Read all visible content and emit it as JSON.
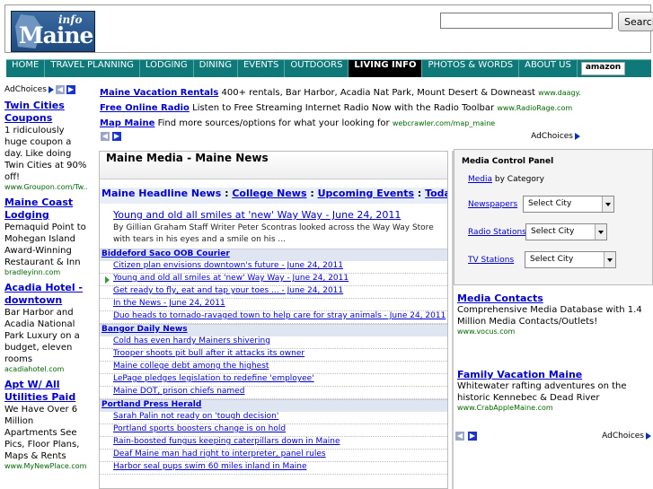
{
  "header": {
    "logo_word": "Maine",
    "logo_info": "info",
    "search_value": "",
    "search_button": "Search"
  },
  "nav": {
    "items": [
      "HOME",
      "TRAVEL PLANNING",
      "LODGING",
      "DINING",
      "EVENTS",
      "OUTDOORS",
      "LIVING INFO",
      "PHOTOS & WORDS",
      "ABOUT US"
    ],
    "active": "LIVING INFO",
    "amazon": "amazon"
  },
  "left_ads": {
    "adchoices": "AdChoices",
    "ads": [
      {
        "title": "Twin Cities Coupons",
        "desc": "1 ridiculously huge coupon a day. Like doing Twin Cities at 90% off!",
        "url": "www.Groupon.com/Tw..."
      },
      {
        "title": "Maine Coast Lodging",
        "desc": "Pemaquid Point to Mohegan Island Award-Winning Restaurant & Inn",
        "url": "bradleyinn.com"
      },
      {
        "title": "Acadia Hotel - downtown",
        "desc": "Bar Harbor and Acadia National Park Luxury on a budget, eleven rooms",
        "url": "acadiahotel.com"
      },
      {
        "title": "Apt W/ All Utilities Paid",
        "desc": "We Have Over 6 Million Apartments See Pics, Floor Plans, Maps & Rents",
        "url": "www.MyNewPlace.com"
      }
    ]
  },
  "top_ads": {
    "rows": [
      {
        "title": "Maine Vacation Rentals",
        "desc": "400+ rentals, Bar Harbor, Acadia Nat Park, Mount Desert & Downeast",
        "url": "www.daagy.com/For_Rent"
      },
      {
        "title": "Free Online Radio",
        "desc": "Listen to Free Streaming Internet Radio Now with the Radio Toolbar",
        "url": "www.RadioRage.com"
      },
      {
        "title": "Map Maine",
        "desc": "Find more sources/options for what your looking for",
        "url": "webcrawler.com/map_maine"
      }
    ],
    "adchoices": "AdChoices"
  },
  "main": {
    "title": "Maine Media - Maine News",
    "tabs": [
      "Maine Headline News",
      "College News",
      "Upcoming Events",
      "Today's Events (Tw"
    ],
    "featured": {
      "headline": "Young and old all smiles at 'new' Way Way - June 24, 2011",
      "byline": "By Gillian Graham Staff Writer Peter Scontras looked across the Way Way Store with tears in his eyes and a smile on his ..."
    },
    "sections": [
      {
        "name": "Biddeford Saco OOB Courier",
        "items": [
          "Citizen plan envisions downtown's future - June 24, 2011",
          "Young and old all smiles at 'new' Way Way - June 24, 2011",
          "Get ready to fly, eat and tap your toes ... - June 24, 2011",
          "In the News - June 24, 2011",
          "Duo heads to tornado-ravaged town to help care for stray animals - June 24, 2011"
        ]
      },
      {
        "name": "Bangor Daily News",
        "items": [
          "Cold has even hardy Mainers shivering",
          "Trooper shoots pit bull after it attacks its owner",
          "Maine college debt among the highest",
          "LePage pledges legislation to redefine 'employee'",
          "Maine DOT, prison chiefs named"
        ]
      },
      {
        "name": "Portland Press Herald",
        "items": [
          "Sarah Palin not ready on 'tough decision'",
          "Portland sports boosters change is on hold",
          "Rain-boosted fungus keeping caterpillars down in Maine",
          "Deaf Maine man had right to interpreter, panel rules",
          "Harbor seal pups swim 60 miles inland in Maine"
        ]
      }
    ]
  },
  "media_panel": {
    "title": "Media Control Panel",
    "by_category_link": "Media",
    "by_category_text": " by Category",
    "rows": [
      {
        "label": "Newspapers",
        "select": "Select City"
      },
      {
        "label": "Radio Stations",
        "select": "Select City"
      },
      {
        "label": "TV Stations",
        "select": "Select City"
      }
    ]
  },
  "right_ads": {
    "ads": [
      {
        "title": "Media Contacts",
        "desc": "Comprehensive Media Database with 1.4 Million Media Contacts/Outlets!",
        "url": "www.vocus.com"
      },
      {
        "title": "Family Vacation Maine",
        "desc": "Whitewater rafting adventures on the historic Kennebec & Dead River",
        "url": "www.CrabAppleMaine.com"
      }
    ],
    "adchoices": "AdChoices"
  }
}
